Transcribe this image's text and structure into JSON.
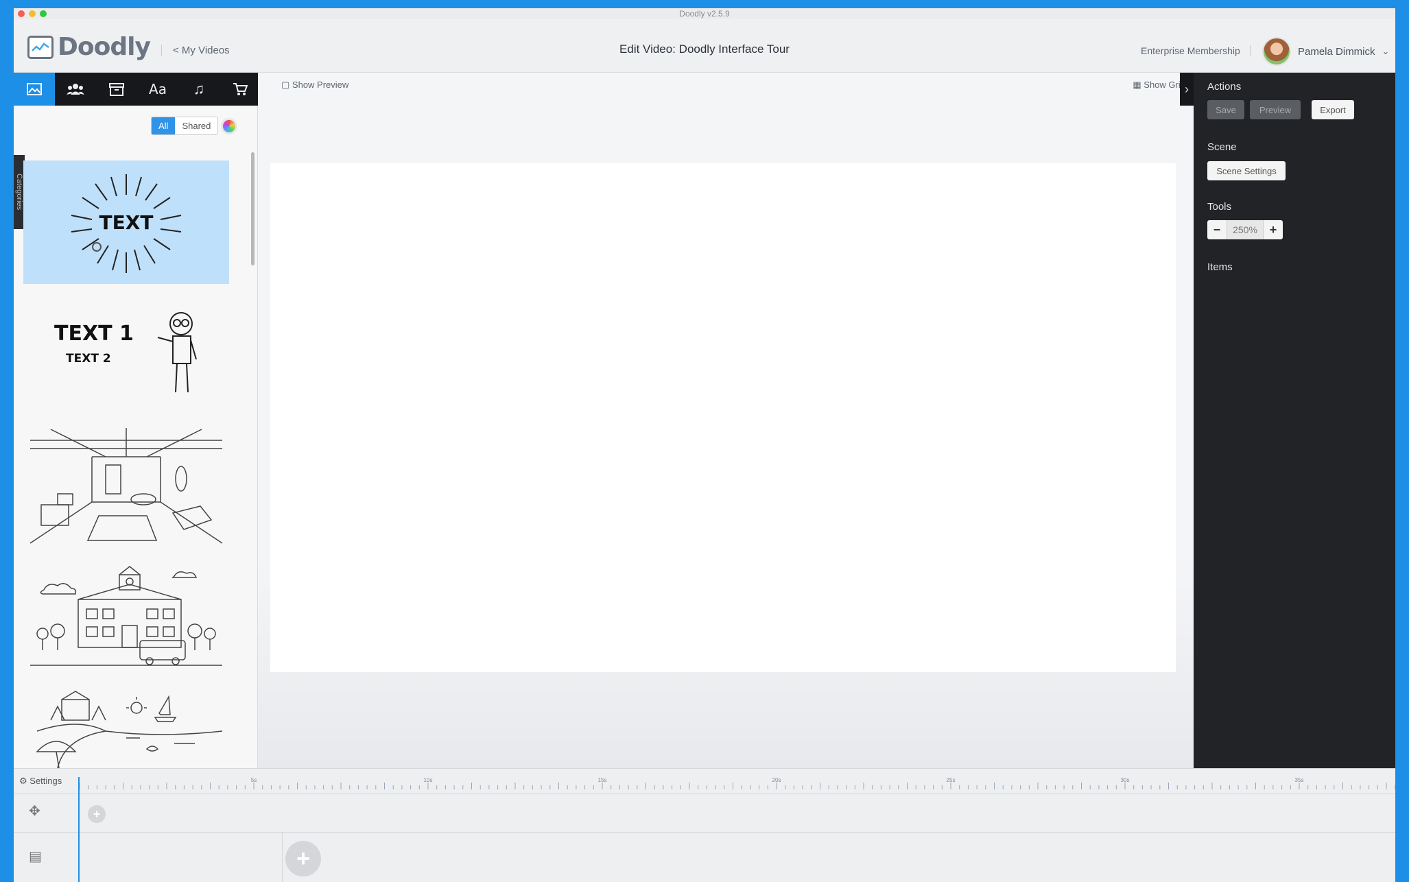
{
  "window": {
    "title": "Doodly v2.5.9"
  },
  "header": {
    "logo_text": "Doodly",
    "back_link": "< My Videos",
    "title": "Edit Video: Doodly Interface Tour",
    "membership": "Enterprise Membership",
    "user_name": "Pamela Dimmick"
  },
  "toolbar": {
    "icons": [
      "image-icon",
      "characters-icon",
      "props-icon",
      "text-icon",
      "music-icon",
      "cart-icon"
    ]
  },
  "sidebar": {
    "categories_label": "Categories",
    "filter_all": "All",
    "filter_shared": "Shared",
    "thumb1_text": "TEXT",
    "thumb2_text1": "TEXT 1",
    "thumb2_text2": "TEXT 2"
  },
  "canvas": {
    "show_preview": "Show Preview",
    "show_grid": "Show Grid"
  },
  "right_panel": {
    "actions_label": "Actions",
    "save": "Save",
    "preview": "Preview",
    "export": "Export",
    "scene_label": "Scene",
    "scene_settings": "Scene Settings",
    "tools_label": "Tools",
    "zoom_value": "250%",
    "items_label": "Items"
  },
  "timeline": {
    "settings_label": "Settings",
    "ruler_labels": [
      "5s",
      "10s",
      "15s",
      "20s",
      "25s",
      "30s",
      "35s"
    ]
  },
  "colors": {
    "accent": "#1e8fe6",
    "panel_dark": "#212327"
  }
}
